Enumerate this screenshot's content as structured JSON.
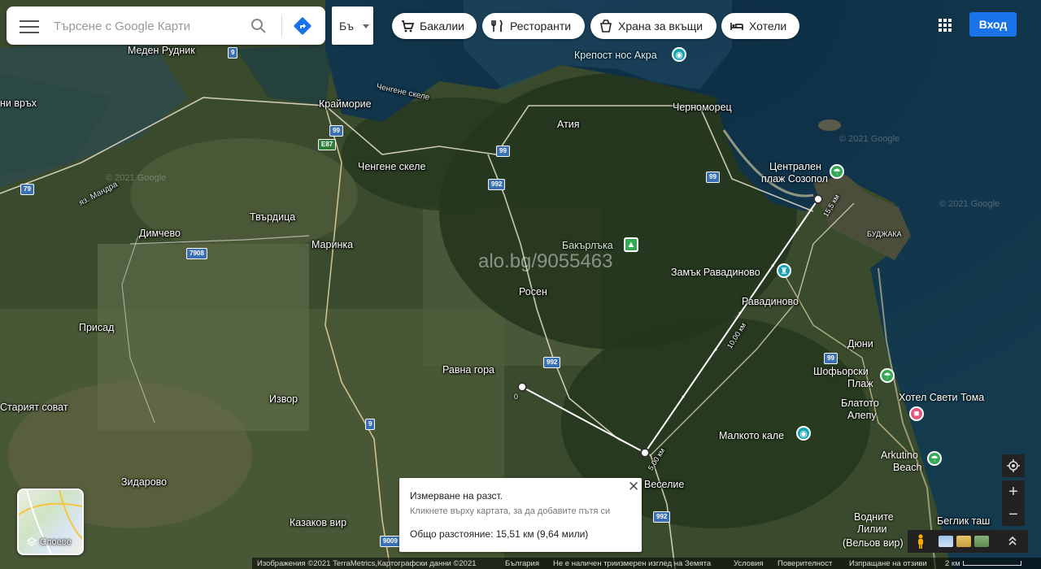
{
  "search": {
    "placeholder": "Търсене с Google Карти"
  },
  "language": {
    "selected": "Бъ"
  },
  "chips": [
    {
      "label": "Бакалии",
      "icon": "cart-icon"
    },
    {
      "label": "Ресторанти",
      "icon": "fork-knife-icon"
    },
    {
      "label": "Храна за вкъщи",
      "icon": "takeout-bag-icon"
    },
    {
      "label": "Хотели",
      "icon": "bed-icon"
    }
  ],
  "header": {
    "signin_label": "Вход"
  },
  "places": {
    "meden_rudnik": "Меден Рудник",
    "kraimorie": "Крайморие",
    "chengene_skele_bay": "Ченгене скеле",
    "chengene_skele": "Ченгене скеле",
    "atiya": "Атия",
    "chernomorets": "Черноморец",
    "krepost_nos_akra": "Крепост нос Акра",
    "tsentralen_plazh": "Централен плаж Созопол",
    "budzhaka": "БУДЖАКА",
    "bakarlaka": "Бакърлъка",
    "zamak_ravadinovo": "Замък Равадиново",
    "ravadinovo": "Равадиново",
    "dimchevo": "Димчево",
    "tvarditsa": "Твърдица",
    "marinka": "Маринка",
    "rosen": "Росен",
    "prisad": "Присад",
    "ravna_gora": "Равна гора",
    "izvor": "Извор",
    "stariyat_sovat": "Старият сoват",
    "zidarovo": "Зидарово",
    "kazakov_vir": "Казаков вир",
    "veselie": "Веселие",
    "dyuni": "Дюни",
    "shoforski_plazh": "Шофьорски Плаж",
    "blato_alepu": "Блатото Алепу",
    "hotel_sveti_toma": "Хотел Свети Тома",
    "malkoto_kale": "Малкото кале",
    "arkutino_beach": "Arkutino Beach",
    "beglik_tash": "Беглик таш",
    "vodnite_lilii": "Водните Лилии (Вельов вир)",
    "vodnite_lilii_1": "Водните",
    "vodnite_lilii_2": "Лилии",
    "vodnite_lilii_3": "(Вельов вир)",
    "ni_vrah": "ни връх",
    "ez_mandra": "яз. Мандра",
    "tsentralen_1": "Централен",
    "tsentralen_2": "плаж Созопол",
    "shoforski_1": "Шофьорски",
    "shoforski_2": "Плаж",
    "blato_1": "Блатото",
    "blato_2": "Алепу",
    "arkutino_1": "Arkutino",
    "arkutino_2": "Beach"
  },
  "roads": [
    "9",
    "99",
    "E87",
    "79",
    "7908",
    "992",
    "9009"
  ],
  "measure_labels": {
    "seg1": "15,5 км",
    "seg2": "10,00 км",
    "seg3": "5,00 км",
    "seg4": "0"
  },
  "measure": {
    "title": "Измерване на разст.",
    "hint": "Кликнете върху картата, за да добавите пътя си",
    "total": "Общо разстояние: 15,51 км (9,64 мили)"
  },
  "layers": {
    "label": "Слоеве"
  },
  "watermark": "alo.bg/9055463",
  "google_watermark": "© 2021 Google",
  "footer": {
    "imagery": "Изображения ©2021 TerraMetrics,Картографски данни ©2021",
    "country": "България",
    "no3d": "Не е наличен триизмерен изглед на Земята",
    "terms": "Условия",
    "privacy": "Поверителност",
    "feedback": "Изпращане на отзиви",
    "scale": "2 км"
  },
  "colors": {
    "accent": "#1a73e8",
    "poi_teal": "#12a4b3",
    "poi_green": "#34a853",
    "poi_pink": "#e8567c",
    "road_shield": "#3b6fb6"
  }
}
